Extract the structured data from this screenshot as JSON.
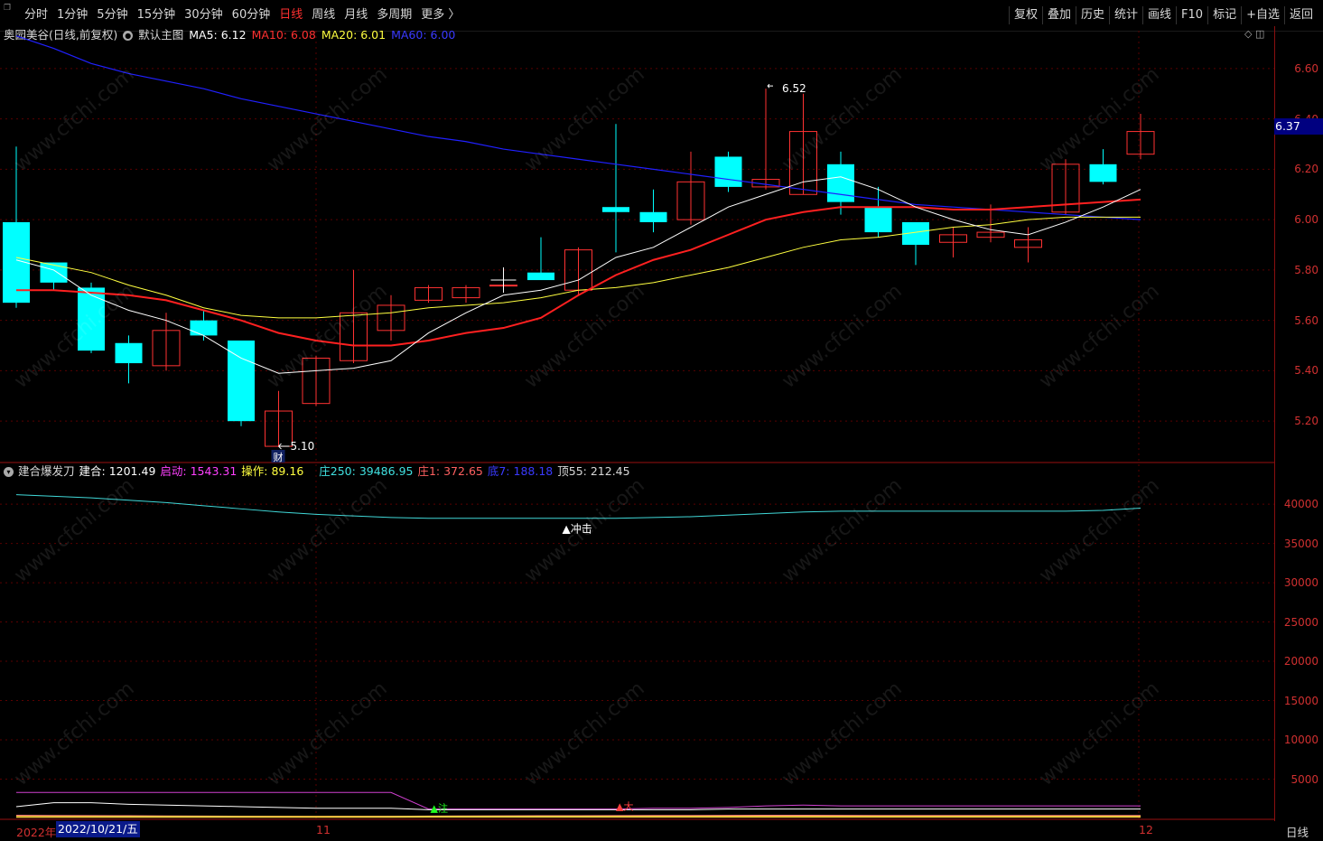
{
  "toolbar": {
    "left_items": [
      "分时",
      "1分钟",
      "5分钟",
      "15分钟",
      "30分钟",
      "60分钟",
      "日线",
      "周线",
      "月线",
      "多周期",
      "更多 〉"
    ],
    "active_index": 6,
    "right_items": [
      "复权",
      "叠加",
      "历史",
      "统计",
      "画线",
      "F10",
      "标记",
      "+自选",
      "返回"
    ]
  },
  "legend": {
    "stock": "奥园美谷(日线,前复权)",
    "template": "默认主图",
    "ma5": "MA5: 6.12",
    "ma10": "MA10: 6.08",
    "ma20": "MA20: 6.01",
    "ma60": "MA60: 6.00"
  },
  "indicator": {
    "name": "建合爆发刀",
    "jianhe": "建合: 1201.49",
    "qidong": "启动: 1543.31",
    "caozuo": "操作: 89.16",
    "zhuang250": "庄250: 39486.95",
    "zhuang1": "庄1: 372.65",
    "di7": "底7: 188.18",
    "ding55": "顶55: 212.45",
    "signal": "▲冲击",
    "zhu": "▲注",
    "da": "▲大"
  },
  "price_axis": [
    "6.60",
    "6.40",
    "6.20",
    "6.00",
    "5.80",
    "5.60",
    "5.40",
    "5.20"
  ],
  "ind_axis": [
    "40000",
    "35000",
    "30000",
    "25000",
    "20000",
    "15000",
    "10000",
    "5000"
  ],
  "current_price": "6.37",
  "annotations": {
    "high": "6.52",
    "low": "5.10",
    "cai": "财"
  },
  "dates": {
    "year": "2022年",
    "cursor": "2022/10/21/五",
    "nov": "11",
    "dec": "12"
  },
  "period": "日线",
  "watermark": "www.cfchi.com",
  "colors": {
    "up": "#ff3232",
    "down": "#00ffff",
    "ma5": "#ffffff",
    "ma10": "#ff2020",
    "ma20": "#ffff40",
    "ma60": "#2020ff",
    "grid": "#5a0000"
  },
  "chart_data": {
    "type": "candlestick",
    "ohlc": [
      [
        5.99,
        6.29,
        5.65,
        5.67
      ],
      [
        5.83,
        5.83,
        5.72,
        5.75
      ],
      [
        5.73,
        5.75,
        5.47,
        5.48
      ],
      [
        5.51,
        5.54,
        5.35,
        5.43
      ],
      [
        5.42,
        5.63,
        5.4,
        5.56
      ],
      [
        5.6,
        5.64,
        5.52,
        5.54
      ],
      [
        5.52,
        5.52,
        5.18,
        5.2
      ],
      [
        5.1,
        5.32,
        5.1,
        5.24
      ],
      [
        5.27,
        5.46,
        5.26,
        5.45
      ],
      [
        5.44,
        5.8,
        5.43,
        5.63
      ],
      [
        5.56,
        5.7,
        5.52,
        5.66
      ],
      [
        5.68,
        5.74,
        5.67,
        5.73
      ],
      [
        5.69,
        5.74,
        5.67,
        5.73
      ],
      [
        5.74,
        5.8,
        5.72,
        5.74
      ],
      [
        5.79,
        5.93,
        5.76,
        5.76
      ],
      [
        5.72,
        5.89,
        5.7,
        5.88
      ],
      [
        6.05,
        6.38,
        5.87,
        6.03
      ],
      [
        6.03,
        6.12,
        5.95,
        5.99
      ],
      [
        6.0,
        6.27,
        5.98,
        6.15
      ],
      [
        6.25,
        6.27,
        6.11,
        6.13
      ],
      [
        6.13,
        6.52,
        6.12,
        6.16
      ],
      [
        6.1,
        6.5,
        6.1,
        6.35
      ],
      [
        6.22,
        6.27,
        6.02,
        6.07
      ],
      [
        6.05,
        6.13,
        5.93,
        5.95
      ],
      [
        5.99,
        5.99,
        5.82,
        5.9
      ],
      [
        5.91,
        5.97,
        5.85,
        5.94
      ],
      [
        5.93,
        6.06,
        5.91,
        5.95
      ],
      [
        5.89,
        5.97,
        5.83,
        5.92
      ],
      [
        6.03,
        6.24,
        6.02,
        6.22
      ],
      [
        6.22,
        6.28,
        6.14,
        6.15
      ],
      [
        6.26,
        6.42,
        6.24,
        6.35
      ]
    ],
    "ma5": [
      5.84,
      5.8,
      5.7,
      5.64,
      5.6,
      5.54,
      5.45,
      5.39,
      5.4,
      5.41,
      5.44,
      5.55,
      5.63,
      5.7,
      5.72,
      5.76,
      5.85,
      5.89,
      5.97,
      6.05,
      6.1,
      6.15,
      6.17,
      6.12,
      6.05,
      6.0,
      5.96,
      5.94,
      5.99,
      6.05,
      6.12
    ],
    "ma10": [
      5.72,
      5.72,
      5.71,
      5.7,
      5.68,
      5.64,
      5.6,
      5.55,
      5.52,
      5.5,
      5.5,
      5.52,
      5.55,
      5.57,
      5.61,
      5.7,
      5.78,
      5.84,
      5.88,
      5.94,
      6.0,
      6.03,
      6.05,
      6.05,
      6.05,
      6.04,
      6.04,
      6.05,
      6.06,
      6.07,
      6.08
    ],
    "ma20": [
      5.85,
      5.82,
      5.79,
      5.74,
      5.7,
      5.65,
      5.62,
      5.61,
      5.61,
      5.62,
      5.63,
      5.65,
      5.66,
      5.67,
      5.69,
      5.72,
      5.73,
      5.75,
      5.78,
      5.81,
      5.85,
      5.89,
      5.92,
      5.93,
      5.95,
      5.97,
      5.98,
      6.0,
      6.01,
      6.01,
      6.01
    ],
    "ma60": [
      6.73,
      6.68,
      6.62,
      6.58,
      6.55,
      6.52,
      6.48,
      6.45,
      6.42,
      6.39,
      6.36,
      6.33,
      6.31,
      6.28,
      6.26,
      6.24,
      6.22,
      6.2,
      6.18,
      6.16,
      6.14,
      6.12,
      6.1,
      6.08,
      6.06,
      6.05,
      6.04,
      6.03,
      6.02,
      6.01,
      6.0
    ],
    "ylim": [
      5.05,
      6.7
    ],
    "indicator_ylim": [
      0,
      43000
    ],
    "zhuang250": [
      41200,
      41000,
      40800,
      40500,
      40200,
      39800,
      39400,
      39000,
      38700,
      38500,
      38300,
      38200,
      38200,
      38200,
      38200,
      38200,
      38200,
      38300,
      38400,
      38600,
      38800,
      39000,
      39100,
      39100,
      39100,
      39100,
      39100,
      39100,
      39100,
      39200,
      39500
    ],
    "qidong": [
      3300,
      3300,
      3300,
      3300,
      3300,
      3300,
      3300,
      3300,
      3300,
      3300,
      3300,
      1200,
      1200,
      1200,
      1200,
      1200,
      1200,
      1300,
      1300,
      1400,
      1600,
      1700,
      1600,
      1600,
      1600,
      1600,
      1600,
      1600,
      1600,
      1600,
      1600
    ],
    "jianhe": [
      1500,
      2000,
      2000,
      1800,
      1700,
      1600,
      1500,
      1400,
      1300,
      1300,
      1300,
      1100,
      1100,
      1100,
      1100,
      1100,
      1100,
      1100,
      1100,
      1200,
      1200,
      1200,
      1200,
      1200,
      1200,
      1200,
      1200,
      1200,
      1200,
      1200,
      1200
    ],
    "zhuang1": [
      400,
      380,
      360,
      340,
      320,
      300,
      280,
      260,
      250,
      260,
      280,
      300,
      320,
      330,
      340,
      350,
      360,
      370,
      380,
      390,
      400,
      400,
      390,
      380,
      370,
      370,
      370,
      370,
      370,
      370,
      372
    ],
    "ding55": [
      200,
      200,
      200,
      200,
      200,
      200,
      200,
      200,
      200,
      200,
      200,
      210,
      210,
      210,
      210,
      210,
      210,
      210,
      210,
      210,
      210,
      210,
      210,
      210,
      210,
      210,
      210,
      210,
      210,
      212,
      212
    ]
  }
}
